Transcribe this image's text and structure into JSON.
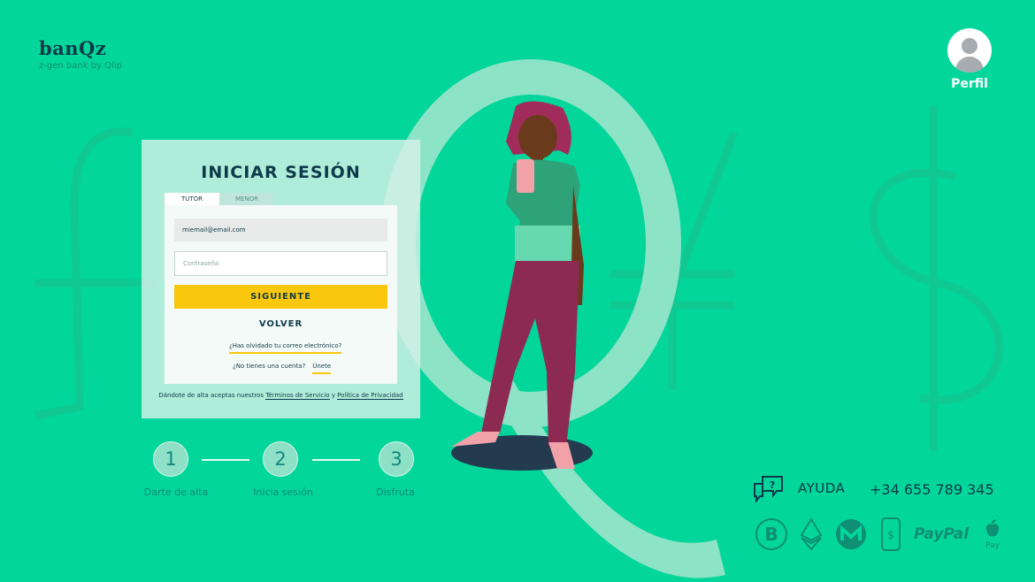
{
  "brand": {
    "name": "banQz",
    "tagline": "z-gen bank by Qlip"
  },
  "profile": {
    "label": "Perfil"
  },
  "login": {
    "title": "INICIAR SESIÓN",
    "tabs": [
      {
        "label": "TUTOR",
        "active": true
      },
      {
        "label": "MENOR",
        "active": false
      }
    ],
    "email_value": "miemail@email.com",
    "password_placeholder": "Contraseña",
    "next_label": "SIGUIENTE",
    "back_label": "VOLVER",
    "forgot_label": "¿Has olvidado tu correo electrónico?",
    "no_account_label": "¿No tienes una cuenta?",
    "join_label": "Únete",
    "terms_prefix": "Dándote de alta aceptas nuestros",
    "terms_link": "Términos de Servicio",
    "terms_and": "y",
    "privacy_link": "Política de Privacidad"
  },
  "steps": [
    {
      "number": "1",
      "label": "Darte de alta"
    },
    {
      "number": "2",
      "label": "Inicia sesión"
    },
    {
      "number": "3",
      "label": "Disfruta"
    }
  ],
  "footer": {
    "help_label": "AYUDA",
    "phone": "+34 655 789 345",
    "payment_methods": [
      "bitcoin-icon",
      "ethereum-icon",
      "monero-icon",
      "mobile-pay-icon",
      "PayPal",
      "apple-pay-icon"
    ],
    "paypal_text": "PayPal",
    "applepay_text": "Pay"
  },
  "colors": {
    "background": "#02d69a",
    "accent": "#fbc70c",
    "text": "#0d3a48"
  }
}
